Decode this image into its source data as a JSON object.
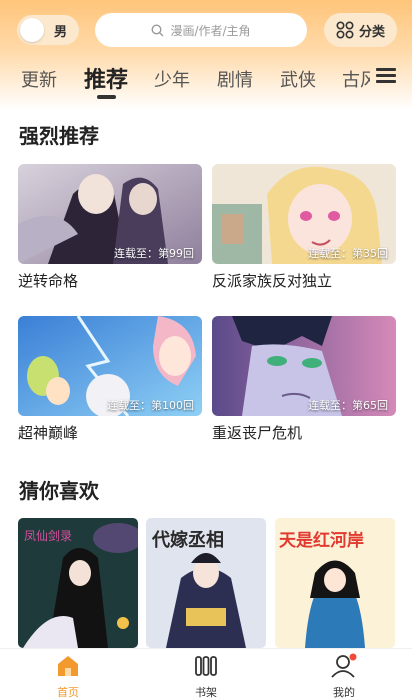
{
  "header": {
    "gender_label": "男",
    "search_placeholder": "漫画/作者/主角",
    "category_label": "分类",
    "tabs": [
      "更新",
      "推荐",
      "少年",
      "剧情",
      "武侠",
      "古风"
    ]
  },
  "sections": {
    "recommend": {
      "title": "强烈推荐",
      "cards": [
        {
          "title": "逆转命格",
          "badge": "连载至：第99回"
        },
        {
          "title": "反派家族反对独立",
          "badge": "连载至：第35回"
        },
        {
          "title": "超神巅峰",
          "badge": "连载至：第100回"
        },
        {
          "title": "重返丧尸危机",
          "badge": "连载至：第65回"
        }
      ]
    },
    "guess": {
      "title": "猜你喜欢",
      "covers": [
        "凤仙剑录",
        "代嫁丞相",
        "天是红河岸"
      ]
    }
  },
  "bottom_nav": {
    "items": [
      {
        "label": "首页",
        "icon": "home-icon"
      },
      {
        "label": "书架",
        "icon": "bookshelf-icon"
      },
      {
        "label": "我的",
        "icon": "profile-icon"
      }
    ]
  },
  "colors": {
    "accent": "#f39a2e",
    "header_orange": "#ffc57a",
    "notify_dot": "#f04a3a"
  }
}
